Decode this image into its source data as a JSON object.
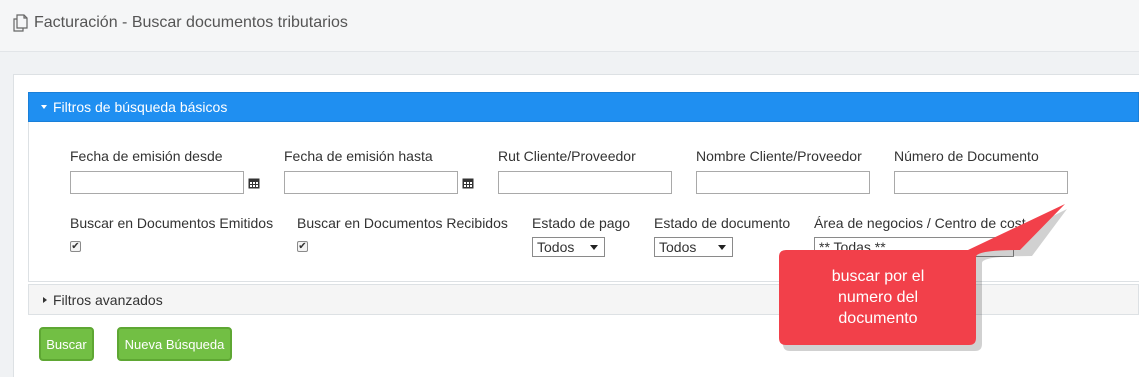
{
  "header": {
    "title": "Facturación - Buscar documentos tributarios",
    "icon": "document-copy-icon"
  },
  "basic_filters": {
    "title": "Filtros de búsqueda básicos",
    "fecha_desde": {
      "label": "Fecha de emisión desde",
      "value": ""
    },
    "fecha_hasta": {
      "label": "Fecha de emisión hasta",
      "value": ""
    },
    "rut": {
      "label": "Rut Cliente/Proveedor",
      "value": ""
    },
    "nombre": {
      "label": "Nombre Cliente/Proveedor",
      "value": ""
    },
    "numero": {
      "label": "Número de Documento",
      "value": ""
    },
    "emitidos": {
      "label": "Buscar en Documentos Emitidos",
      "checked": true
    },
    "recibidos": {
      "label": "Buscar en Documentos Recibidos",
      "checked": true
    },
    "estado_pago": {
      "label": "Estado de pago",
      "value": "Todos"
    },
    "estado_documento": {
      "label": "Estado de documento",
      "value": "Todos"
    },
    "area": {
      "label": "Área de negocios / Centro de cost",
      "value": "** Todas **"
    }
  },
  "advanced_filters": {
    "title": "Filtros avanzados"
  },
  "buttons": {
    "buscar": "Buscar",
    "nueva": "Nueva Búsqueda"
  },
  "callout": {
    "line1": "buscar por el",
    "line2": "numero del",
    "line3": "documento",
    "color": "#f2404a"
  },
  "colors": {
    "header_blue": "#1f8ff1",
    "button_green": "#72bf44"
  }
}
